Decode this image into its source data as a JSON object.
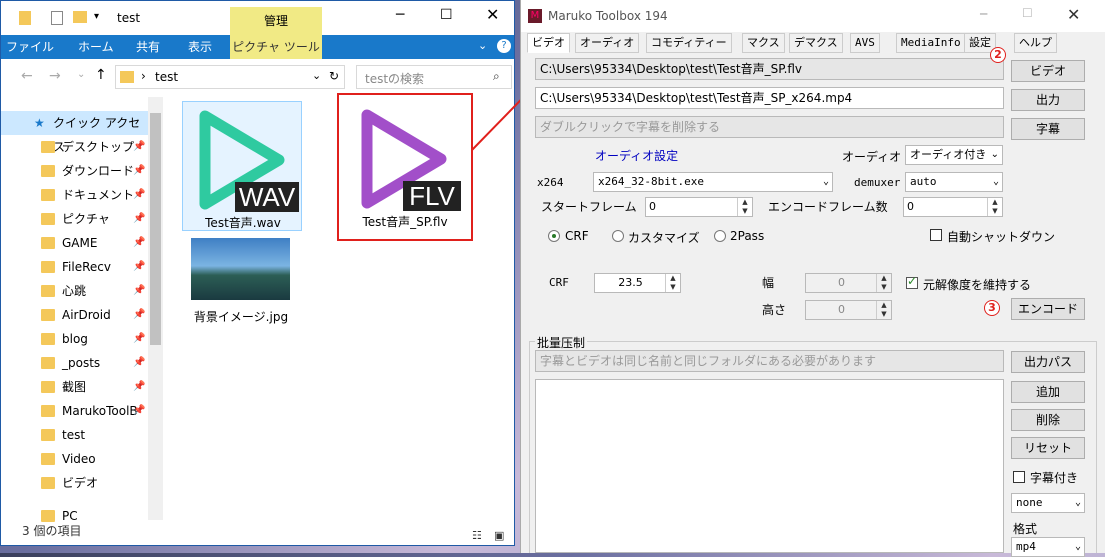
{
  "explorer": {
    "title": "test",
    "manage_tab": "管理",
    "ribbon": [
      "ファイル",
      "ホーム",
      "共有",
      "表示",
      "ピクチャ ツール"
    ],
    "address": "test",
    "search_placeholder": "testの検索",
    "nav_items": [
      {
        "label": "クイック アクセス",
        "pinned": false
      },
      {
        "label": "デスクトップ",
        "pinned": true
      },
      {
        "label": "ダウンロード",
        "pinned": true
      },
      {
        "label": "ドキュメント",
        "pinned": true
      },
      {
        "label": "ピクチャ",
        "pinned": true
      },
      {
        "label": "GAME",
        "pinned": true
      },
      {
        "label": "FileRecv",
        "pinned": true
      },
      {
        "label": "心跳",
        "pinned": true
      },
      {
        "label": "AirDroid",
        "pinned": true
      },
      {
        "label": "blog",
        "pinned": true
      },
      {
        "label": "_posts",
        "pinned": true
      },
      {
        "label": "截图",
        "pinned": true
      },
      {
        "label": "MarukoToolB",
        "pinned": true
      },
      {
        "label": "test",
        "pinned": false
      },
      {
        "label": "Video",
        "pinned": false
      },
      {
        "label": "ビデオ",
        "pinned": false
      },
      {
        "label": "PC",
        "pinned": false
      }
    ],
    "files": [
      {
        "name": "Test音声.wav",
        "badge": "WAV",
        "color": "#2fcaa0"
      },
      {
        "name": "Test音声_SP.flv",
        "badge": "FLV",
        "color": "#a24fc9"
      },
      {
        "name": "背景イメージ.jpg"
      }
    ],
    "status": "3 個の項目"
  },
  "maruko": {
    "title": "Maruko Toolbox 194",
    "tabs": [
      "ビデオ",
      "オーディオ",
      "コモディティー",
      "マクス",
      "デマクス",
      "AVS",
      "MediaInfo",
      "設定",
      "ヘルプ"
    ],
    "video_path": "C:\\Users\\95334\\Desktop\\test\\Test音声_SP.flv",
    "output_path": "C:\\Users\\95334\\Desktop\\test\\Test音声_SP_x264.mp4",
    "subtitle_placeholder": "ダブルクリックで字幕を削除する",
    "btn_video": "ビデオ",
    "btn_output": "出力",
    "btn_subtitle": "字幕",
    "audio_settings": "オーディオ設定",
    "audio_label": "オーディオ",
    "audio_value": "オーディオ付き",
    "x264_label": "x264",
    "x264_value": "x264_32-8bit.exe",
    "demuxer_label": "demuxer",
    "demuxer_value": "auto",
    "start_frame_label": "スタートフレーム",
    "start_frame": "0",
    "encode_frames_label": "エンコードフレーム数",
    "encode_frames": "0",
    "crf_radio": "CRF",
    "custom_radio": "カスタマイズ",
    "twopass_radio": "2Pass",
    "auto_shutdown": "自動シャットダウン",
    "crf_label": "CRF",
    "crf_value": "23.5",
    "width_label": "幅",
    "width_value": "0",
    "height_label": "高さ",
    "height_value": "0",
    "keep_res": "元解像度を維持する",
    "btn_encode": "エンコード",
    "batch_title": "批量压制",
    "batch_hint": "字幕とビデオは同じ名前と同じフォルダにある必要があります",
    "btn_outpath": "出力パス",
    "btn_add": "追加",
    "btn_delete": "削除",
    "btn_reset": "リセット",
    "with_subtitle": "字幕付き",
    "sub_combo": "none",
    "format_label": "格式",
    "format_value": "mp4",
    "marker2": "2",
    "marker3": "3"
  },
  "colors": {
    "annotation": "#e0201c",
    "ribbon": "#1979ca",
    "manage": "#f1ea85"
  }
}
